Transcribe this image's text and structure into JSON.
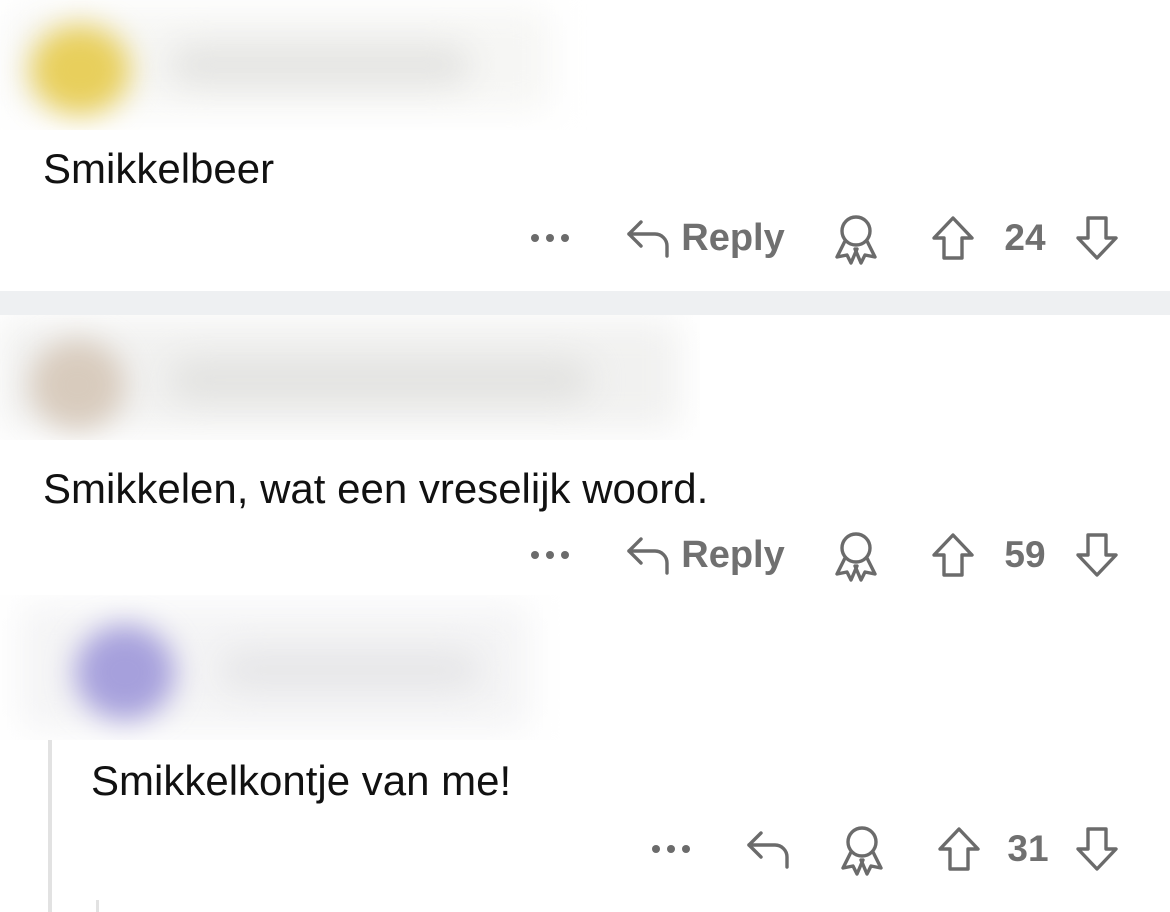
{
  "comments": [
    {
      "text": "Smikkelbeer",
      "score": "24",
      "reply_label": "Reply",
      "avatar_color": "#e6cf6a"
    },
    {
      "text": "Smikkelen, wat een vreselijk woord.",
      "score": "59",
      "reply_label": "Reply",
      "avatar_color": "#d9cfc2"
    },
    {
      "text": "Smikkelkontje van me!",
      "score": "31",
      "reply_label": "",
      "avatar_color": "#a9a3d9"
    }
  ],
  "icons": {
    "more": "more-options-icon",
    "reply": "reply-arrow-icon",
    "award": "award-icon",
    "upvote": "upvote-arrow-icon",
    "downvote": "downvote-arrow-icon"
  },
  "colors": {
    "divider": "#eef0f2",
    "action_gray": "#6b6b6b"
  }
}
